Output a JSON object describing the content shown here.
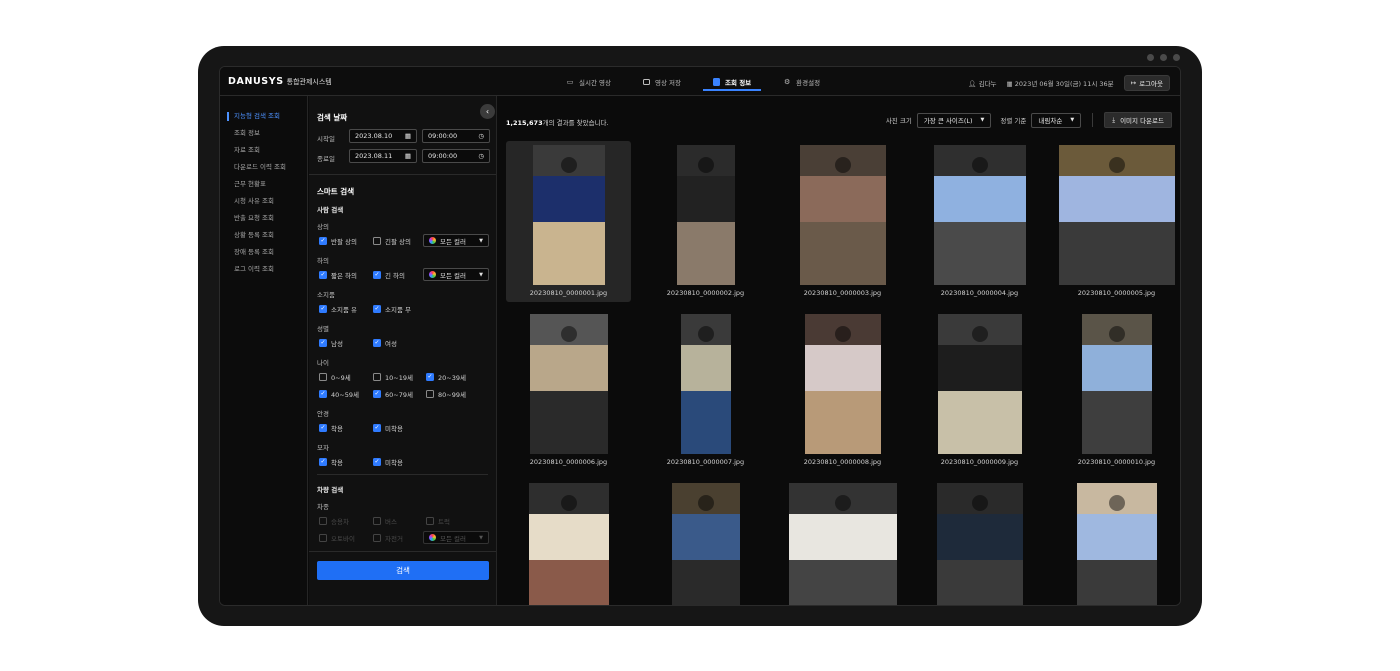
{
  "app": {
    "brand": "DANUSYS",
    "subtitle": "통합관제시스템"
  },
  "nav": [
    {
      "label": "실시간 영상",
      "icon": "camera-icon"
    },
    {
      "label": "영상 저장",
      "icon": "film-icon"
    },
    {
      "label": "조회 정보",
      "icon": "document-icon",
      "active": true
    },
    {
      "label": "환경설정",
      "icon": "gear-icon"
    }
  ],
  "user": {
    "name": "김다누",
    "datetime": "2023년 06월 30일(금) 11시 36분",
    "logout": "로그아웃"
  },
  "sidebar": [
    {
      "label": "지능형 검색 조회",
      "active": true
    },
    {
      "label": "조회 정보"
    },
    {
      "label": "자료 조회"
    },
    {
      "label": "다운로드 이력 조회"
    },
    {
      "label": "근무 현황표"
    },
    {
      "label": "시청 사유 조회"
    },
    {
      "label": "반출 요청 조회"
    },
    {
      "label": "상황 등록 조회"
    },
    {
      "label": "장애 등록 조회"
    },
    {
      "label": "로그 이력 조회"
    }
  ],
  "filter": {
    "date_title": "검색 날짜",
    "start_label": "시작일",
    "start_date": "2023.08.10",
    "start_time": "09:00:00",
    "end_label": "종료일",
    "end_date": "2023.08.11",
    "end_time": "09:00:00",
    "smart_title": "스마트 검색",
    "person_title": "사람 검색",
    "top_label": "상의",
    "top_short": "반팔 상의",
    "top_long": "긴팔 상의",
    "color_all": "모든 컬러",
    "bottom_label": "하의",
    "bottom_short": "짧은 하의",
    "bottom_long": "긴 하의",
    "bag_label": "소지품",
    "bag_yes": "소지품 유",
    "bag_no": "소지품 무",
    "gender_label": "성별",
    "male": "남성",
    "female": "여성",
    "age_label": "나이",
    "age_0": "0~9세",
    "age_10": "10~19세",
    "age_20": "20~39세",
    "age_40": "40~59세",
    "age_60": "60~79세",
    "age_80": "80~99세",
    "glasses_label": "안경",
    "worn": "착용",
    "not_worn": "미착용",
    "hat_label": "모자",
    "vehicle_title": "차량 검색",
    "vtype_label": "차종",
    "car": "승용차",
    "bus": "버스",
    "truck": "트럭",
    "motorcycle": "오토바이",
    "bicycle": "자전거",
    "search_button": "검색"
  },
  "results": {
    "count": "1,215,673",
    "count_suffix": "개의 결과를 찾았습니다.",
    "size_label": "사진 크기",
    "size_value": "가장 큰 사이즈(L)",
    "sort_label": "정렬 기준",
    "sort_value": "내림차순",
    "download": "이미지 다운로드",
    "items": [
      "20230810_0000001.jpg",
      "20230810_0000002.jpg",
      "20230810_0000003.jpg",
      "20230810_0000004.jpg",
      "20230810_0000005.jpg",
      "20230810_0000006.jpg",
      "20230810_0000007.jpg",
      "20230810_0000008.jpg",
      "20230810_0000009.jpg",
      "20230810_0000010.jpg",
      "",
      "",
      "",
      "",
      ""
    ]
  }
}
